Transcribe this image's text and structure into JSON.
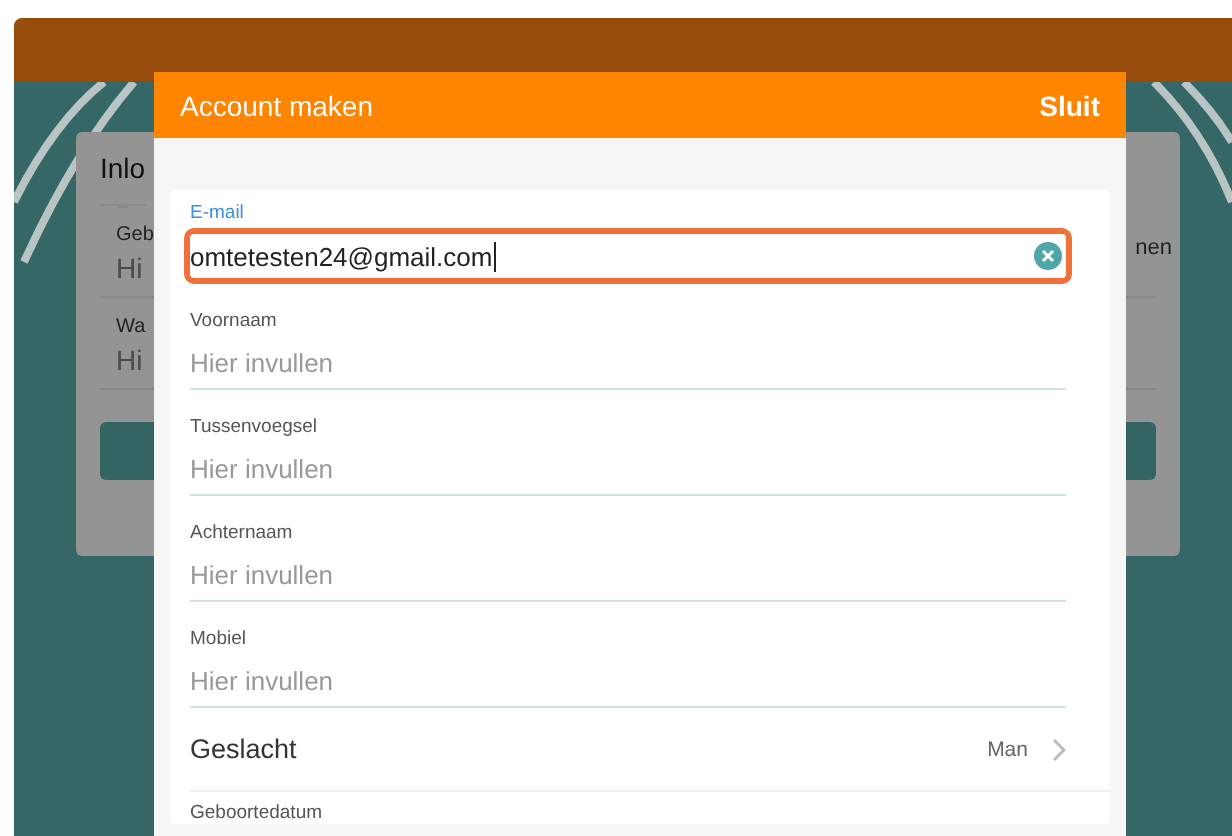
{
  "background": {
    "card_title": "Inlo",
    "fields": [
      {
        "label": "Geb",
        "placeholder": "Hi"
      },
      {
        "label": "Wa",
        "placeholder": "Hi"
      }
    ],
    "side_text": "nen"
  },
  "modal": {
    "title": "Account maken",
    "close_label": "Sluit",
    "fields": [
      {
        "kind": "text",
        "label": "E-mail",
        "value": "omtetesten24@gmail.com",
        "focused": true
      },
      {
        "kind": "text",
        "label": "Voornaam",
        "placeholder": "Hier invullen",
        "focused": false
      },
      {
        "kind": "text",
        "label": "Tussenvoegsel",
        "placeholder": "Hier invullen",
        "focused": false
      },
      {
        "kind": "text",
        "label": "Achternaam",
        "placeholder": "Hier invullen",
        "focused": false
      },
      {
        "kind": "text",
        "label": "Mobiel",
        "placeholder": "Hier invullen",
        "focused": false
      },
      {
        "kind": "select",
        "label": "Geslacht",
        "value": "Man"
      },
      {
        "kind": "date",
        "label": "Geboortedatum"
      }
    ]
  }
}
